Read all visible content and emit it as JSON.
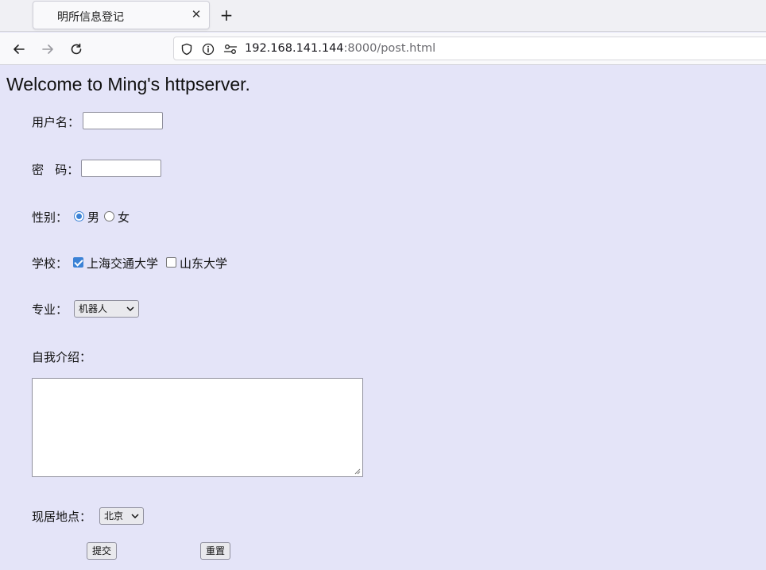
{
  "browser": {
    "tab_title": "明所信息登记",
    "url_host": "192.168.141.144",
    "url_rest": ":8000/post.html"
  },
  "page": {
    "heading": "Welcome to Ming's httpserver.",
    "username_label": "用户名：",
    "username_value": "",
    "password_label": "密   码：",
    "password_value": "",
    "gender_label": "性别：",
    "gender_options": [
      "男",
      "女"
    ],
    "gender_selected": "男",
    "school_label": "学校：",
    "school_options": [
      {
        "label": "上海交通大学",
        "checked": true
      },
      {
        "label": "山东大学",
        "checked": false
      }
    ],
    "major_label": "专业：",
    "major_selected": "机器人",
    "intro_label": "自我介绍：",
    "intro_value": "",
    "location_label": "现居地点：",
    "location_selected": "北京",
    "submit_label": "提交",
    "reset_label": "重置"
  },
  "colors": {
    "page_background": "#e4e4f8",
    "accent": "#3b82d6"
  }
}
